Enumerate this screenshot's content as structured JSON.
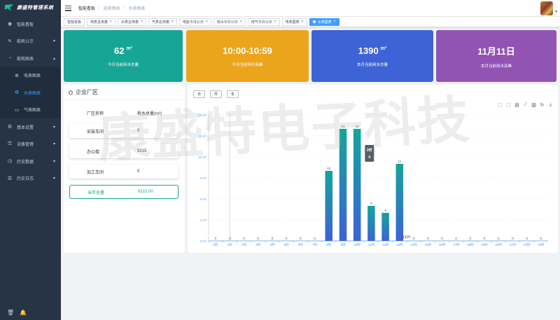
{
  "app": {
    "title": "康盛特管理系统"
  },
  "sidebar": {
    "items": [
      {
        "label": "智能看板",
        "icon": "dashboard-icon"
      },
      {
        "label": "能耗公示",
        "icon": "energy-icon",
        "chevron": "▾"
      },
      {
        "label": "能耗图表",
        "icon": "chart-icon",
        "chevron": "▴"
      }
    ],
    "subitems": [
      {
        "label": "电表图表",
        "icon": "plus-circle-icon"
      },
      {
        "label": "水表图表",
        "icon": "gear-icon",
        "active": true
      },
      {
        "label": "气表图表",
        "icon": "message-icon"
      }
    ],
    "more": [
      {
        "label": "基本设置",
        "icon": "setting-icon",
        "chevron": "▾"
      },
      {
        "label": "设备管理",
        "icon": "device-icon",
        "chevron": "▾"
      },
      {
        "label": "历史数据",
        "icon": "history-icon",
        "chevron": "▾"
      },
      {
        "label": "历史日志",
        "icon": "log-icon",
        "chevron": "▾"
      }
    ]
  },
  "breadcrumb": [
    "智能看板",
    "能耗图表",
    "水表图表"
  ],
  "tags": [
    {
      "label": "智能看板",
      "closable": false
    },
    {
      "label": "电表总用量",
      "closable": true
    },
    {
      "label": "水表总用量",
      "closable": true
    },
    {
      "label": "气表总用量",
      "closable": true
    },
    {
      "label": "电能今日公示",
      "closable": true
    },
    {
      "label": "用水今日公示",
      "closable": true
    },
    {
      "label": "用气今日公示",
      "closable": true
    },
    {
      "label": "电表图表",
      "closable": true
    },
    {
      "label": "水表图表",
      "closable": true,
      "active": true
    }
  ],
  "cards": [
    {
      "value": "62",
      "unit": "m³",
      "label": "今日当前用水总量"
    },
    {
      "value": "10:00-10:59",
      "unit": "",
      "label": "今日当前用水高峰"
    },
    {
      "value": "1390",
      "unit": "m³",
      "label": "本月当前用水总量"
    },
    {
      "value": "11月11日",
      "unit": "",
      "label": "本月当前用水高峰"
    }
  ],
  "factory": {
    "title": "企业厂区",
    "col_name": "厂区名称",
    "col_value": "耗水总量(m³)",
    "rows": [
      {
        "name": "安装车间",
        "value": "0"
      },
      {
        "name": "办公楼",
        "value": "9215"
      },
      {
        "name": "加工车间",
        "value": "0"
      }
    ],
    "total": {
      "name": "当年总量",
      "value": "9215.00"
    }
  },
  "period_buttons": [
    "日",
    "月",
    "年"
  ],
  "toolbox": [
    "zoom-icon",
    "zoom-reset-icon",
    "data-view-icon",
    "line-icon",
    "bar-icon",
    "restore-icon",
    "download-icon"
  ],
  "watermark": "康盛特电子科技",
  "chart_data": {
    "type": "bar",
    "categories": [
      "0时",
      "1时",
      "2时",
      "3时",
      "4时",
      "5时",
      "6时",
      "7时",
      "8时",
      "9时",
      "10时",
      "11时",
      "12时",
      "13时",
      "14时",
      "15时",
      "16时",
      "17时",
      "18时",
      "19时",
      "20时",
      "21时",
      "22时",
      "23时"
    ],
    "values": [
      0,
      0,
      0,
      0,
      0,
      0,
      0,
      0,
      10,
      16,
      16,
      5,
      4,
      11,
      0,
      0,
      0,
      0,
      0,
      0,
      0,
      0,
      0,
      0
    ],
    "ylim": [
      0,
      18
    ],
    "yticks": [
      "0 m³",
      "3 m³",
      "6 m³",
      "9 m³",
      "12 m³",
      "15 m³",
      "18 m³"
    ],
    "current_label": "当前时",
    "tooltip": {
      "title": "2时",
      "value": "0"
    },
    "colors": {
      "top": "#12a69a",
      "bottom": "#3d62d8"
    }
  }
}
